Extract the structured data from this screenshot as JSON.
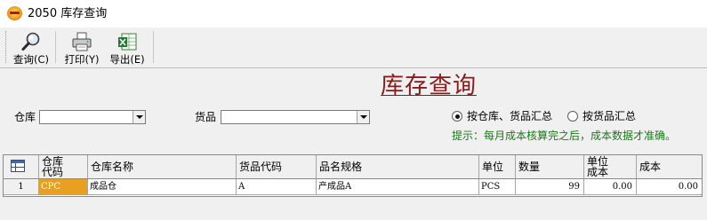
{
  "window": {
    "title": "2050 库存查询"
  },
  "toolbar": {
    "query_label": "查询(C)",
    "print_label": "打印(Y)",
    "export_label": "导出(E)"
  },
  "report": {
    "title": "库存查询"
  },
  "filters": {
    "warehouse_label": "仓库",
    "warehouse_value": "",
    "goods_label": "货品",
    "goods_value": ""
  },
  "summary_mode": {
    "options": [
      {
        "label": "按仓库、货品汇总",
        "selected": true
      },
      {
        "label": "按货品汇总",
        "selected": false
      }
    ]
  },
  "hint": "提示：每月成本核算完之后，成本数据才准确。",
  "grid": {
    "columns": [
      {
        "line1": "仓库",
        "line2": "代码"
      },
      {
        "line1": "仓库名称"
      },
      {
        "line1": "货品代码"
      },
      {
        "line1": "品名规格"
      },
      {
        "line1": "单位"
      },
      {
        "line1": "数量"
      },
      {
        "line1": "单位",
        "line2": "成本"
      },
      {
        "line1": "成本"
      }
    ],
    "rows": [
      {
        "row_no": "1",
        "warehouse_code": "CPC",
        "warehouse_name": "成品仓",
        "goods_code": "A",
        "goods_spec": "产成品A",
        "unit": "PCS",
        "quantity": "99",
        "unit_cost": "0.00",
        "cost": "0.00"
      }
    ]
  },
  "colors": {
    "title_red": "#8b1a1a",
    "hint_green": "#1a7a1a",
    "selected_cell": "#e8a020"
  }
}
